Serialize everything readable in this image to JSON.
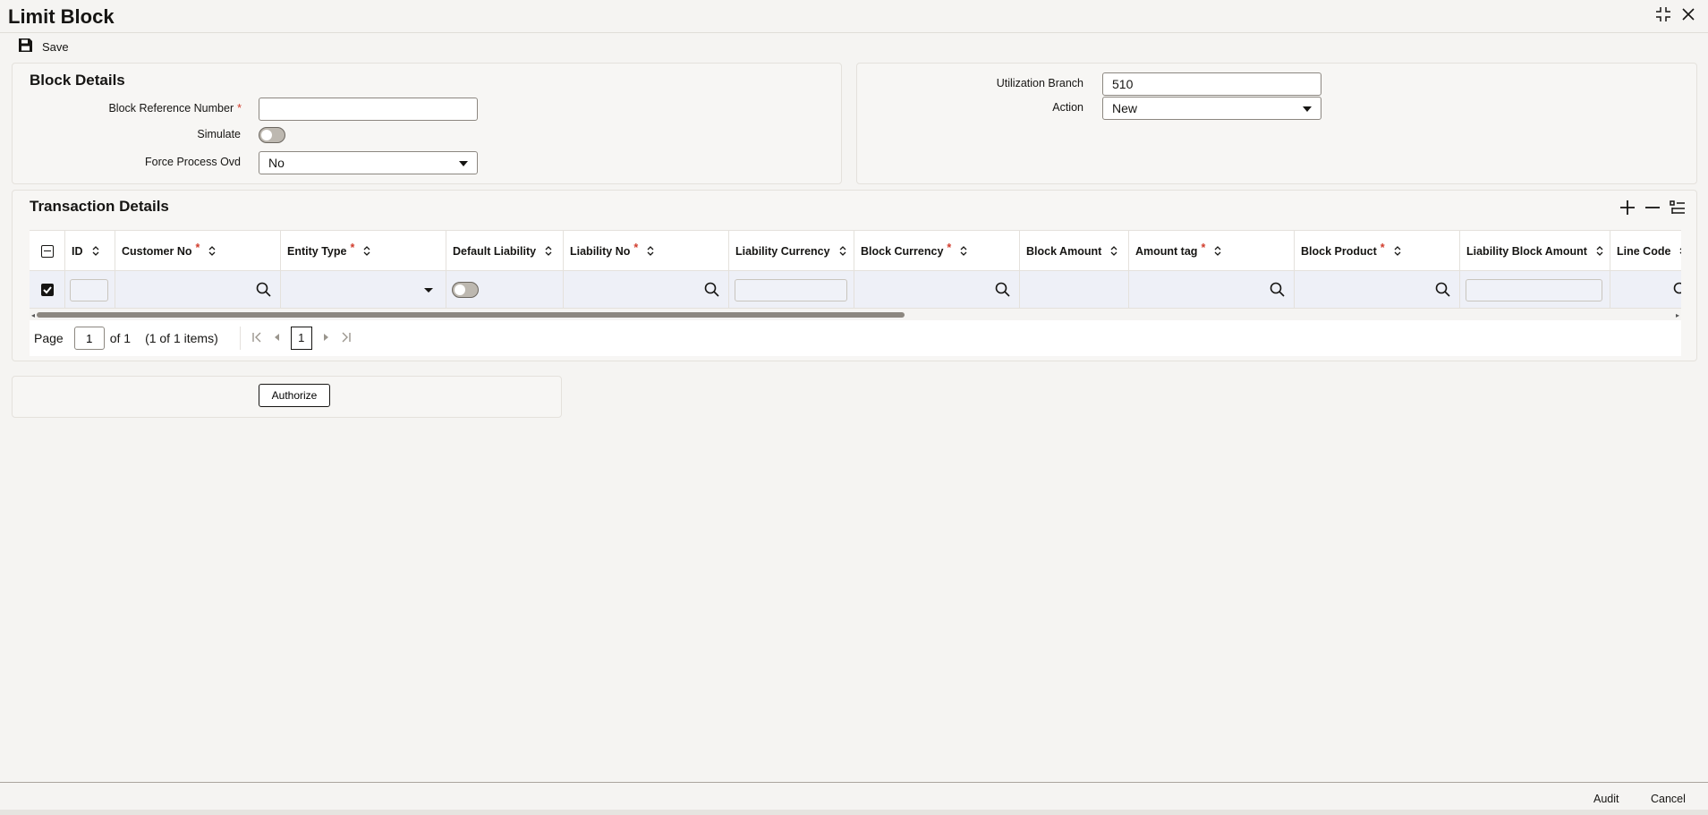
{
  "window": {
    "title": "Limit Block"
  },
  "toolbar": {
    "save_label": "Save"
  },
  "block_details": {
    "section_title": "Block Details",
    "block_reference_number_label": "Block Reference Number",
    "block_reference_number_value": "",
    "simulate_label": "Simulate",
    "simulate_on": false,
    "force_process_ovd_label": "Force Process Ovd",
    "force_process_ovd_value": "No",
    "utilization_branch_label": "Utilization Branch",
    "utilization_branch_value": "510",
    "action_label": "Action",
    "action_value": "New"
  },
  "transaction_details": {
    "section_title": "Transaction Details",
    "columns": [
      {
        "label": "ID",
        "required": false
      },
      {
        "label": "Customer No",
        "required": true
      },
      {
        "label": "Entity Type",
        "required": true
      },
      {
        "label": "Default Liability",
        "required": false
      },
      {
        "label": "Liability No",
        "required": true
      },
      {
        "label": "Liability Currency",
        "required": false
      },
      {
        "label": "Block Currency",
        "required": true
      },
      {
        "label": "Block Amount",
        "required": false
      },
      {
        "label": "Amount tag",
        "required": true
      },
      {
        "label": "Block Product",
        "required": true
      },
      {
        "label": "Liability Block Amount",
        "required": false
      },
      {
        "label": "Line Code",
        "required": false
      }
    ],
    "rows": [
      {
        "selected": true,
        "id": "",
        "customer_no": "",
        "entity_type": "",
        "default_liability": false,
        "liability_no": "",
        "liability_currency": "",
        "block_currency": "",
        "block_amount": "",
        "amount_tag": "",
        "block_product": "",
        "liability_block_amount": "",
        "line_code": ""
      }
    ]
  },
  "pager": {
    "page_label": "Page",
    "page_value": "1",
    "of_label": "of 1",
    "items_label": "(1 of 1 items)",
    "current_page": "1"
  },
  "authorize": {
    "label": "Authorize"
  },
  "footer": {
    "audit_label": "Audit",
    "cancel_label": "Cancel"
  },
  "colors": {
    "required": "#d13c2c",
    "text": "#161513",
    "row_bg": "#eef0f7",
    "panel_bg": "#f7f6f4"
  },
  "icons": [
    "save-icon",
    "collapse-icon",
    "close-icon",
    "add-row-icon",
    "delete-row-icon",
    "single-view-icon",
    "sort-icon",
    "search-icon",
    "checkbox-checked-icon",
    "checkbox-partial-icon"
  ]
}
